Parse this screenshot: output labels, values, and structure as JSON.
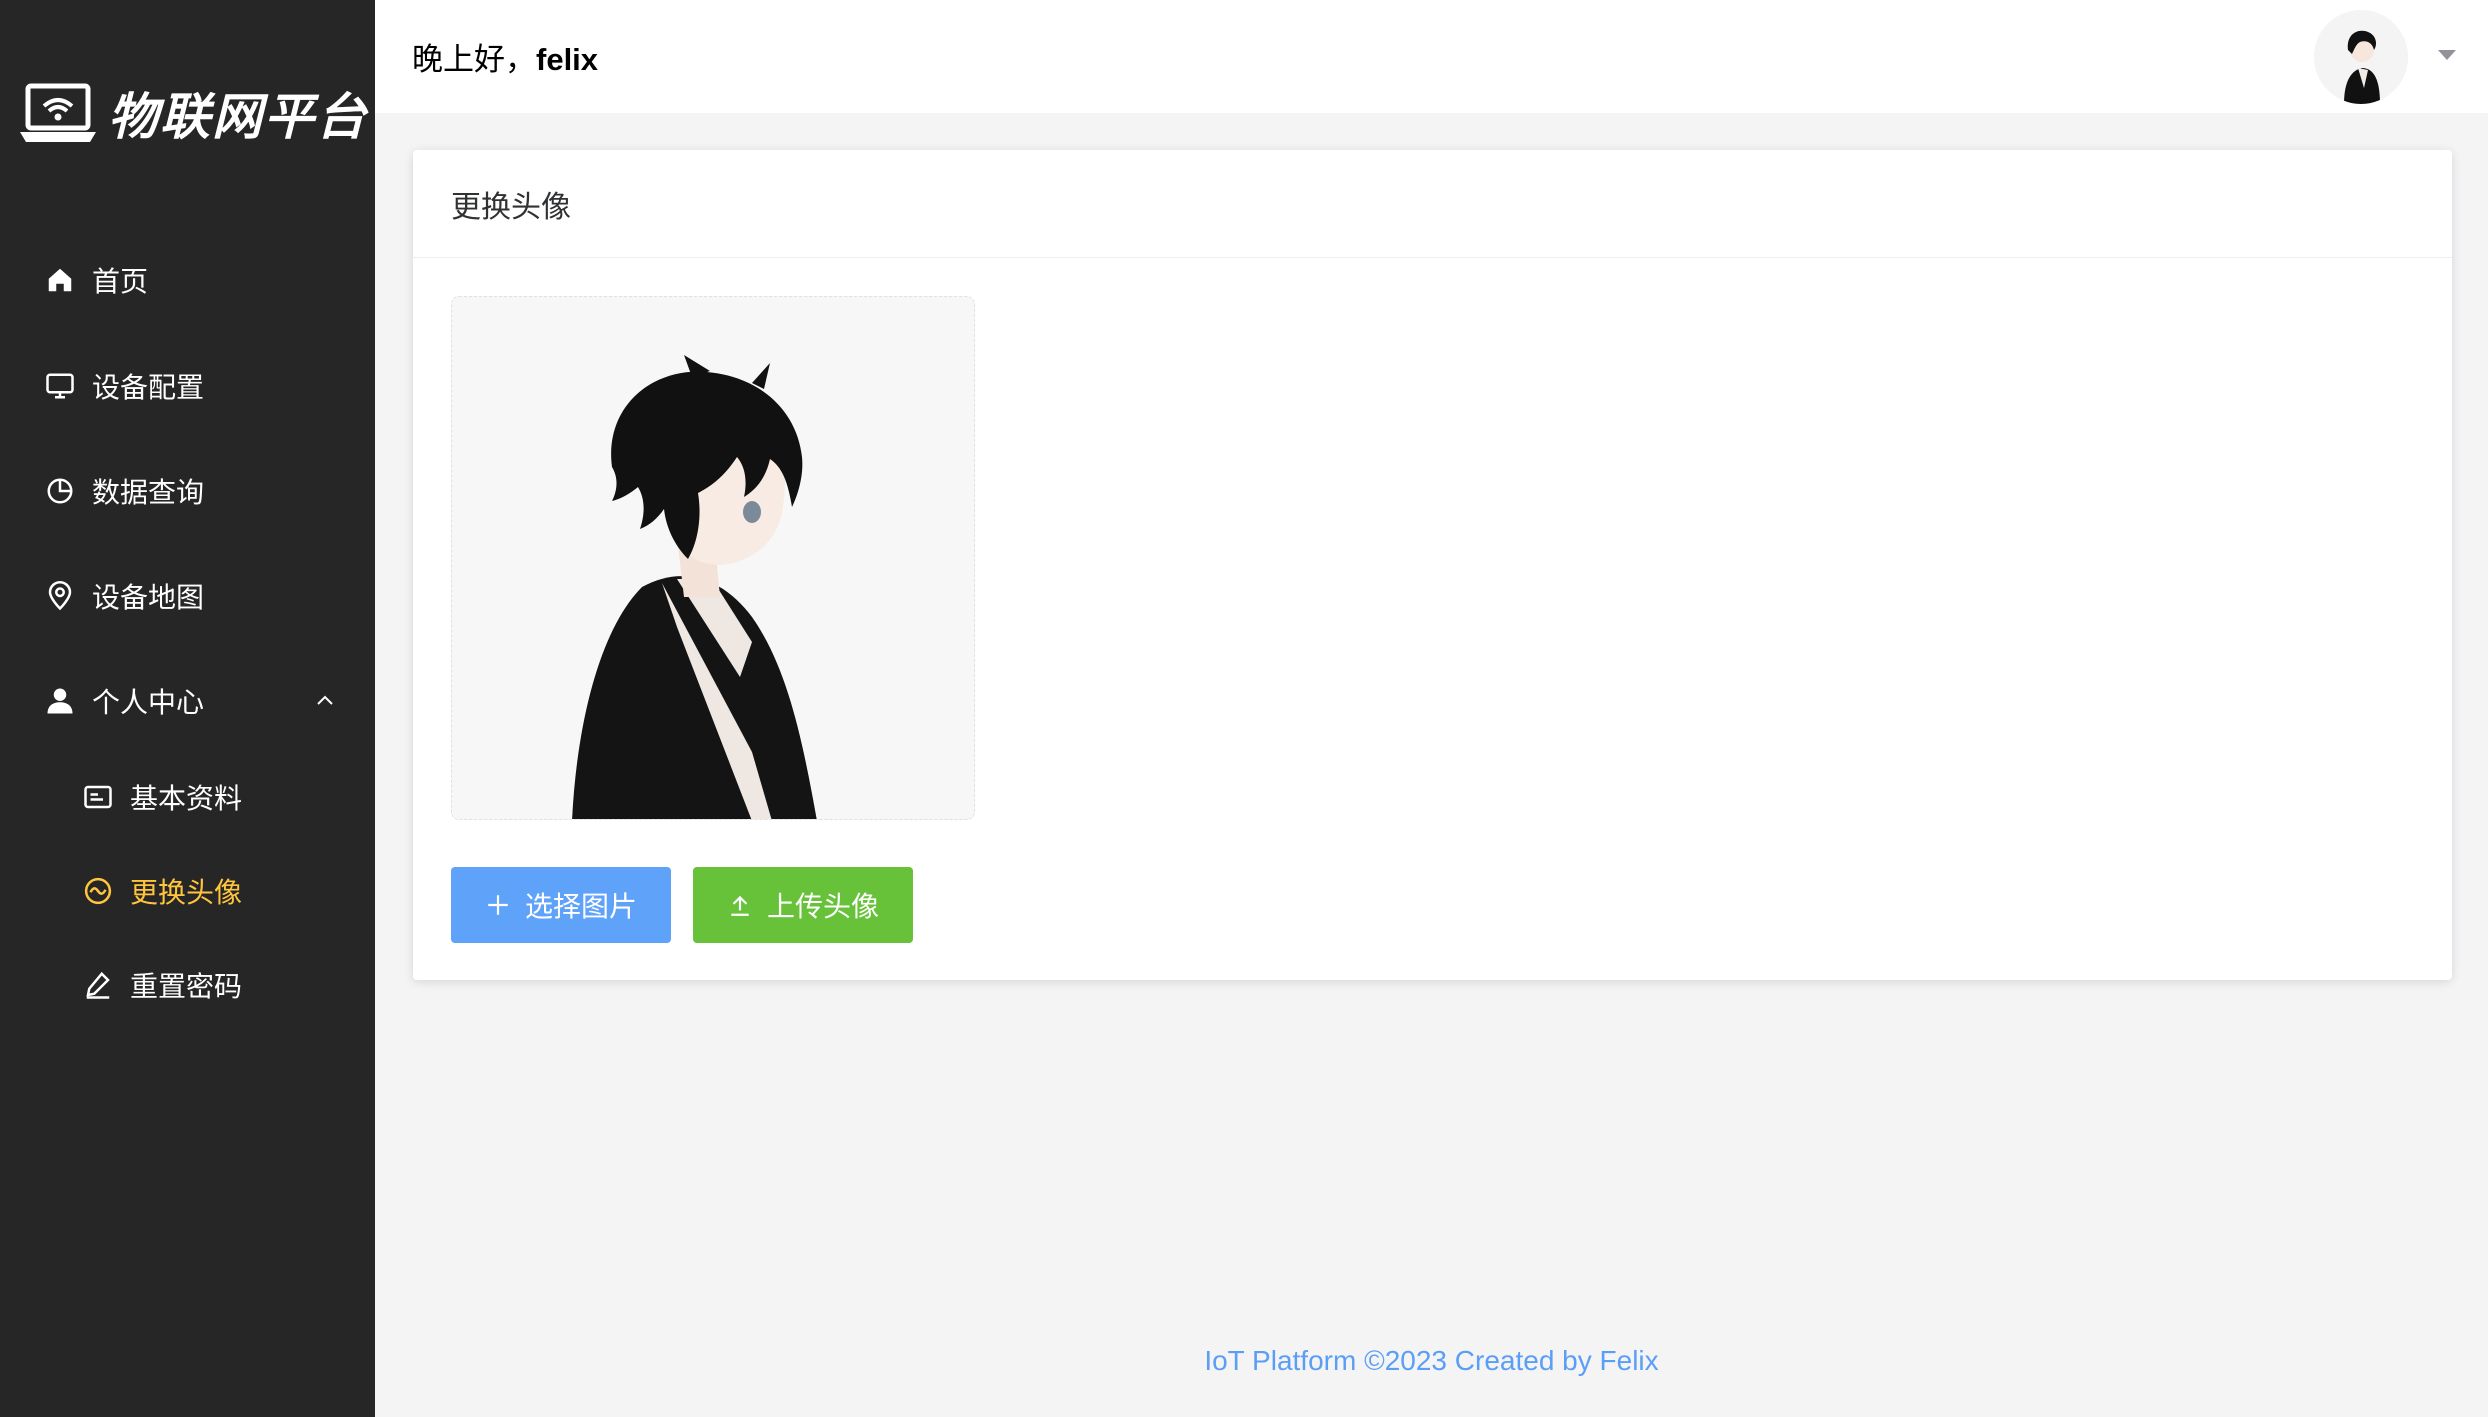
{
  "brand": {
    "name": "物联网平台"
  },
  "header": {
    "greeting_prefix": "晚上好，",
    "username": "felix"
  },
  "sidebar": {
    "items": [
      {
        "label": "首页",
        "icon": "home-icon"
      },
      {
        "label": "设备配置",
        "icon": "monitor-icon"
      },
      {
        "label": "数据查询",
        "icon": "pie-chart-icon"
      },
      {
        "label": "设备地图",
        "icon": "location-pin-icon"
      },
      {
        "label": "个人中心",
        "icon": "user-icon",
        "expanded": true
      }
    ],
    "subitems": [
      {
        "label": "基本资料",
        "icon": "id-card-icon"
      },
      {
        "label": "更换头像",
        "icon": "avatar-face-icon",
        "active": true
      },
      {
        "label": "重置密码",
        "icon": "edit-pen-icon"
      }
    ]
  },
  "card": {
    "title": "更换头像",
    "select_label": "选择图片",
    "upload_label": "上传头像"
  },
  "footer": {
    "text": "IoT Platform ©2023 Created by Felix"
  },
  "colors": {
    "sidebar_bg": "#262626",
    "active": "#ffc53d",
    "primary": "#5fa2f9",
    "success": "#67c23a",
    "footer_text": "#5b9ef5"
  }
}
